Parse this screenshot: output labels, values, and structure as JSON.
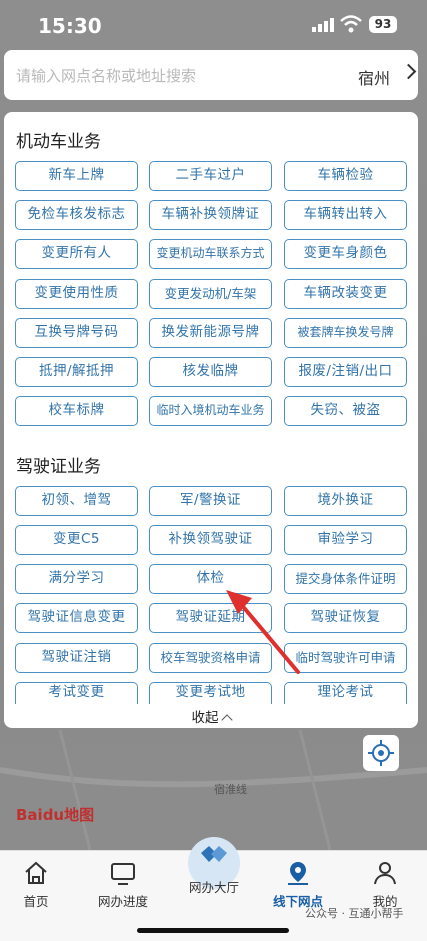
{
  "status": {
    "time": "15:30",
    "battery": "93"
  },
  "search": {
    "placeholder": "请输入网点名称或地址搜索",
    "city": "宿州"
  },
  "vehicle": {
    "title": "机动车业务",
    "buttons": [
      "新车上牌",
      "二手车过户",
      "车辆检验",
      "免检车核发标志",
      "车辆补换领牌证",
      "车辆转出转入",
      "变更所有人",
      "变更机动车联系方式",
      "变更车身颜色",
      "变更使用性质",
      "变更发动机/车架",
      "车辆改装变更",
      "互换号牌号码",
      "换发新能源号牌",
      "被套牌车换发号牌",
      "抵押/解抵押",
      "核发临牌",
      "报废/注销/出口",
      "校车标牌",
      "临时入境机动车业务",
      "失窃、被盗"
    ]
  },
  "license": {
    "title": "驾驶证业务",
    "buttons": [
      "初领、增驾",
      "军/警换证",
      "境外换证",
      "变更C5",
      "补换领驾驶证",
      "审验学习",
      "满分学习",
      "体检",
      "提交身体条件证明",
      "驾驶证信息变更",
      "驾驶证延期",
      "驾驶证恢复",
      "驾驶证注销",
      "校车驾驶资格申请",
      "临时驾驶许可申请",
      "考试变更",
      "变更考试地",
      "理论考试"
    ]
  },
  "collapse_label": "收起",
  "map": {
    "road_label": "宿淮线",
    "logo": "Baidu地图"
  },
  "tabs": [
    {
      "label": "首页",
      "icon": "home-icon"
    },
    {
      "label": "网办进度",
      "icon": "monitor-icon"
    },
    {
      "label": "网办大厅",
      "icon": "handshake-icon"
    },
    {
      "label": "线下网点",
      "icon": "map-pin-icon",
      "active": true
    },
    {
      "label": "我的",
      "icon": "user-icon"
    }
  ],
  "watermark": "公众号 · 互通小帮手",
  "colors": {
    "accent": "#3274aa",
    "active_tab": "#1a5fa5",
    "annotation": "#e0302e"
  }
}
